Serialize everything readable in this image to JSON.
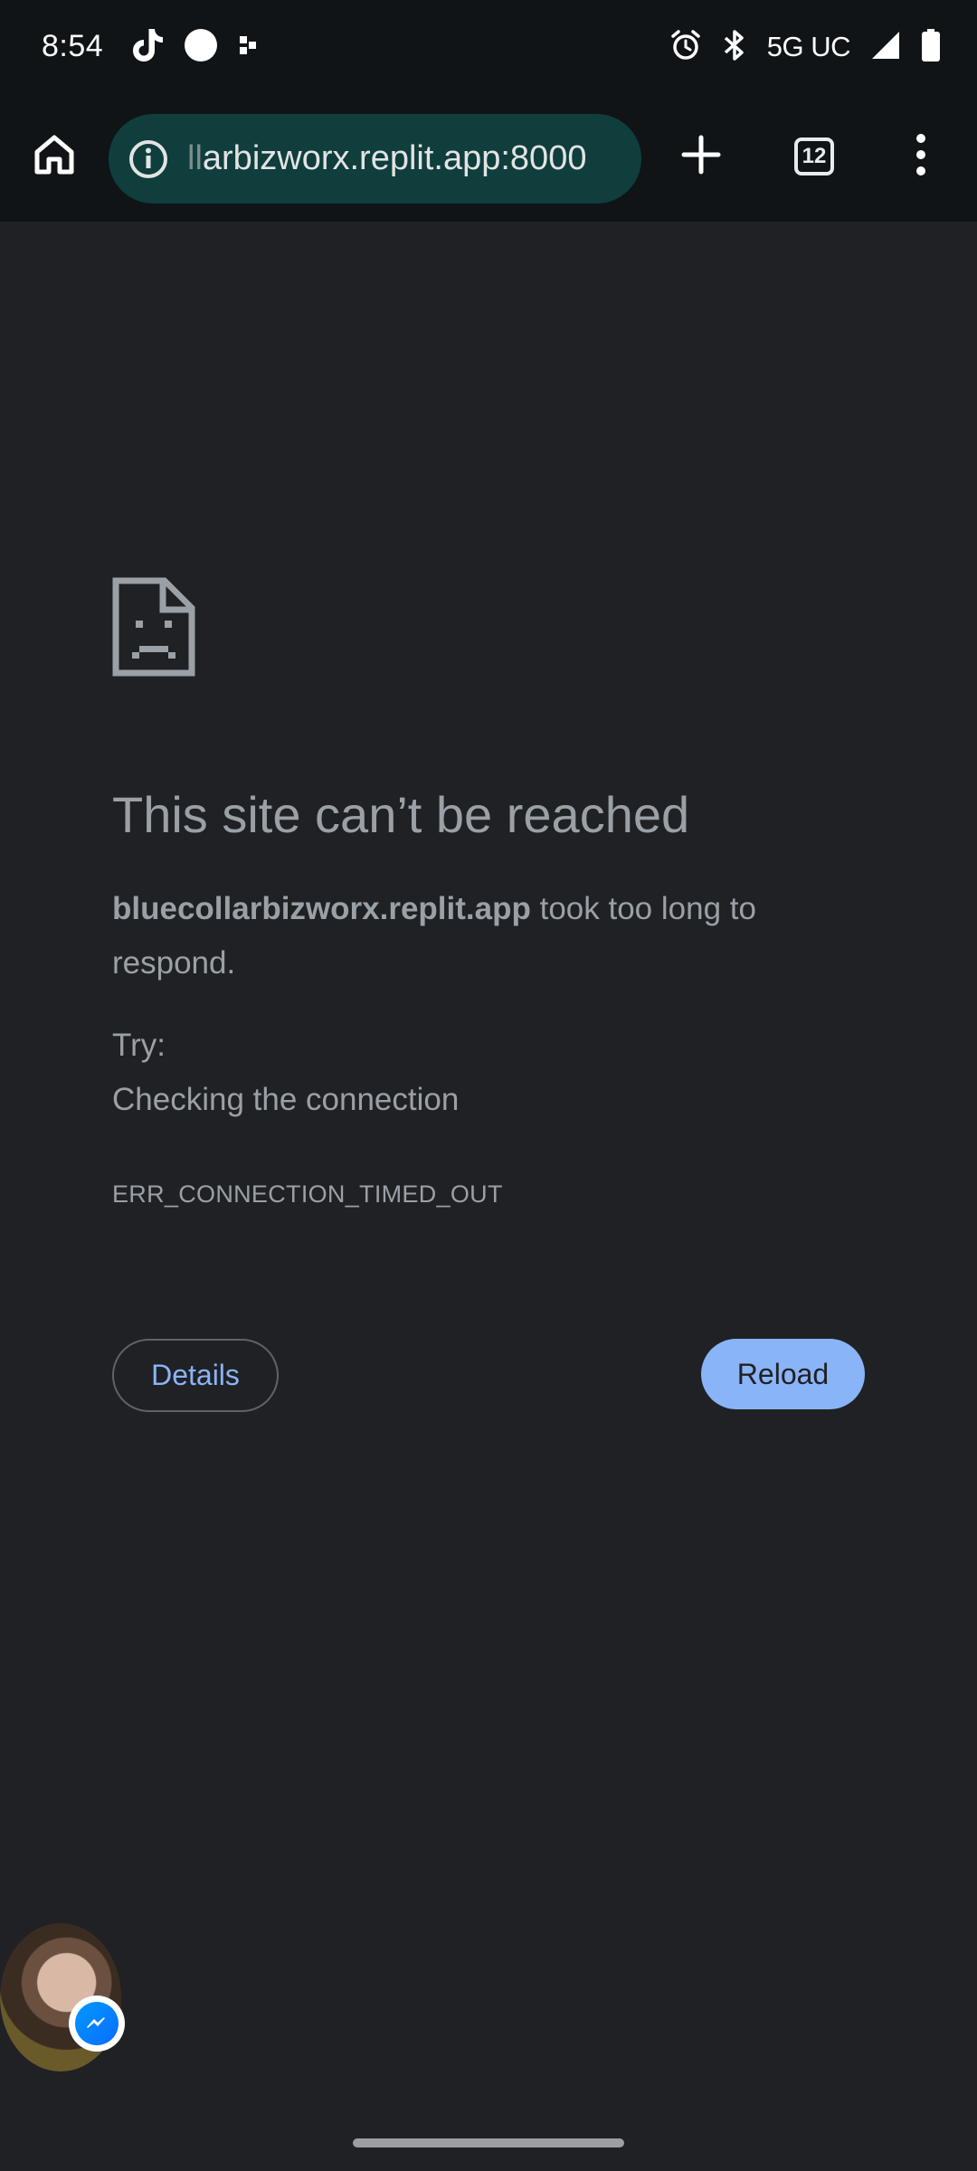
{
  "status_bar": {
    "time": "8:54",
    "network": "5G UC",
    "icons": [
      "tiktok-icon",
      "circle-dot-icon",
      "app-shortcut-icon",
      "alarm-icon",
      "bluetooth-icon",
      "signal-icon",
      "battery-icon"
    ]
  },
  "toolbar": {
    "url_faded_prefix": "ll",
    "url_text": "arbizworx.replit.app:8000",
    "tab_count": "12",
    "icons": [
      "home-icon",
      "site-info-icon",
      "new-tab-icon",
      "tab-switcher-icon",
      "overflow-menu-icon"
    ]
  },
  "error_page": {
    "heading": "This site can’t be reached",
    "host": "bluecollarbizworx.replit.app",
    "message_rest": " took too long to respond.",
    "try_label": "Try:",
    "suggestion": "Checking the connection",
    "error_code": "ERR_CONNECTION_TIMED_OUT",
    "details_label": "Details",
    "reload_label": "Reload"
  },
  "chat_head": {
    "badge_icon": "messenger-icon"
  },
  "colors": {
    "page_bg": "#202124",
    "toolbar_bg": "#111416",
    "omnibox_bg": "#0f3e3d",
    "text": "#9aa0a6",
    "accent": "#8ab4f8"
  }
}
